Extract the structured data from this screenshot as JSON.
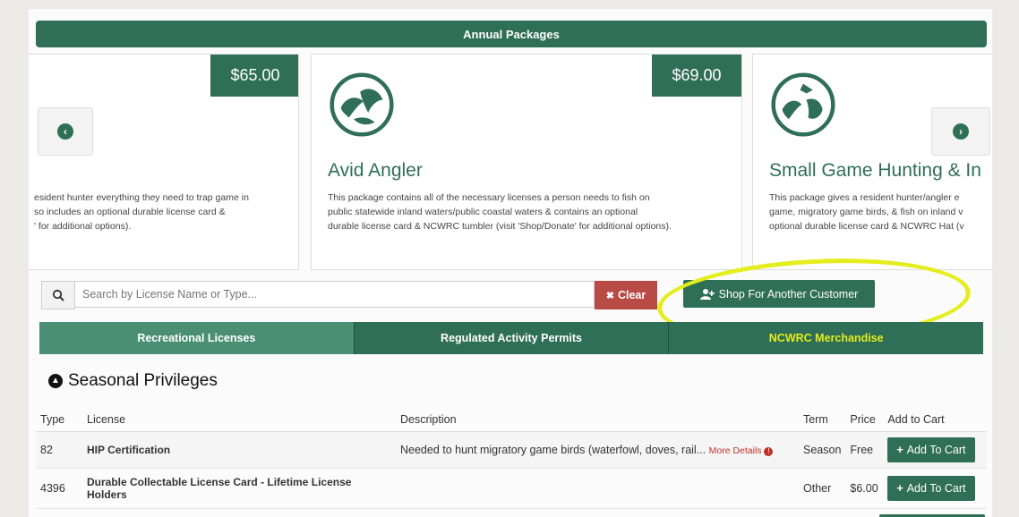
{
  "banner": {
    "title": "Annual Packages"
  },
  "carousel": {
    "cards": [
      {
        "price": "$65.00",
        "title": "",
        "description_lines": [
          "esident hunter everything they need to trap game in",
          "so includes an optional durable license card &",
          "' for additional options)."
        ]
      },
      {
        "price": "$69.00",
        "title": "Avid Angler",
        "description_lines": [
          "This package contains all of the necessary licenses a person needs to fish on",
          "public statewide inland waters/public coastal waters & contains an optional",
          "durable license card & NCWRC tumbler (visit 'Shop/Donate' for additional options)."
        ]
      },
      {
        "price": "",
        "title": "Small Game Hunting & In",
        "description_lines": [
          "This package gives a resident hunter/angler e",
          "game, migratory game birds, & fish on inland v",
          "optional durable license card & NCWRC Hat (v"
        ]
      }
    ],
    "prev_icon": "chevron-left-circle",
    "next_icon": "chevron-right-circle"
  },
  "search": {
    "placeholder": "Search by License Name or Type...",
    "value": "",
    "clear_label": "Clear",
    "clear_icon": "✖"
  },
  "shop_button": {
    "label": "Shop For Another Customer",
    "icon": "add-user"
  },
  "tabs": [
    {
      "label": "Recreational Licenses",
      "active": true
    },
    {
      "label": "Regulated Activity Permits",
      "active": false
    },
    {
      "label": "NCWRC Merchandise",
      "active": false
    }
  ],
  "section": {
    "title": "Seasonal Privileges"
  },
  "table": {
    "headers": [
      "Type",
      "License",
      "Description",
      "Term",
      "Price",
      "Add to Cart"
    ],
    "rows": [
      {
        "type": "82",
        "license": "HIP Certification",
        "description": "Needed to hunt migratory game birds (waterfowl, doves, rail...",
        "more": "More Details",
        "term": "Season",
        "price": "Free",
        "button": "Add To Cart"
      },
      {
        "type": "4396",
        "license": "Durable Collectable License Card - Lifetime License Holders",
        "description": "",
        "more": "",
        "term": "Other",
        "price": "$6.00",
        "button": "Add To Cart"
      }
    ]
  },
  "colors": {
    "brand_green": "#2f6e57",
    "clear_red": "#b94a45",
    "highlight_yellow": "#e4ed1d",
    "link_red": "#c0312b"
  }
}
